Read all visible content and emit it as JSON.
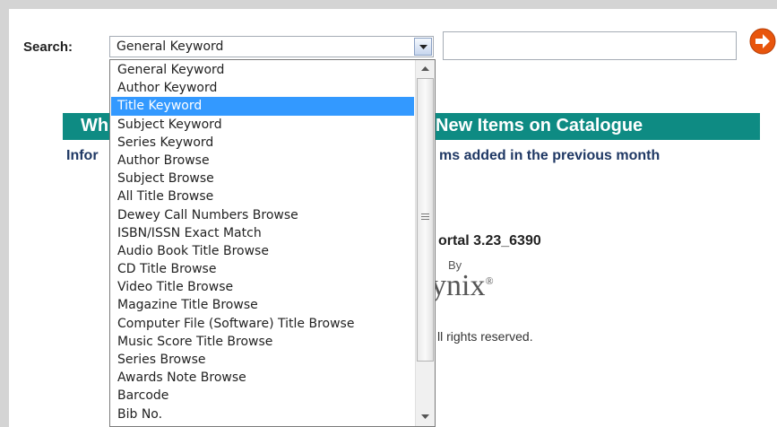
{
  "search": {
    "label": "Search:",
    "selected": "General Keyword",
    "input_value": ""
  },
  "dropdown": {
    "options": [
      "General Keyword",
      "Author Keyword",
      "Title Keyword",
      "Subject Keyword",
      "Series Keyword",
      "Author Browse",
      "Subject Browse",
      "All Title Browse",
      "Dewey Call Numbers Browse",
      "ISBN/ISSN Exact Match",
      "Audio Book Title Browse",
      "CD Title Browse",
      "Video Title Browse",
      "Magazine Title Browse",
      "Computer File (Software) Title Browse",
      "Music Score Title Browse",
      "Series Browse",
      "Awards Note Browse",
      "Barcode",
      "Bib No."
    ],
    "highlighted": "Title Keyword"
  },
  "banner": {
    "left_text": "Wh",
    "right_text": "New Items on Catalogue"
  },
  "info": {
    "left_text": "Infor",
    "right_text": "ms added in the previous month"
  },
  "footer": {
    "version": "ortal 3.23_6390",
    "by": "By",
    "logo": "ynix",
    "logo_mark": "®",
    "rights": "ll rights reserved."
  },
  "icons": {
    "go": "arrow-right-circle-icon",
    "dropdown": "chevron-down-icon",
    "scroll_up": "scroll-up-arrow-icon",
    "scroll_down": "scroll-down-arrow-icon"
  },
  "colors": {
    "banner": "#0e8b83",
    "go_button": "#e8550c",
    "highlight": "#3399ff",
    "info_text": "#1f3864"
  }
}
